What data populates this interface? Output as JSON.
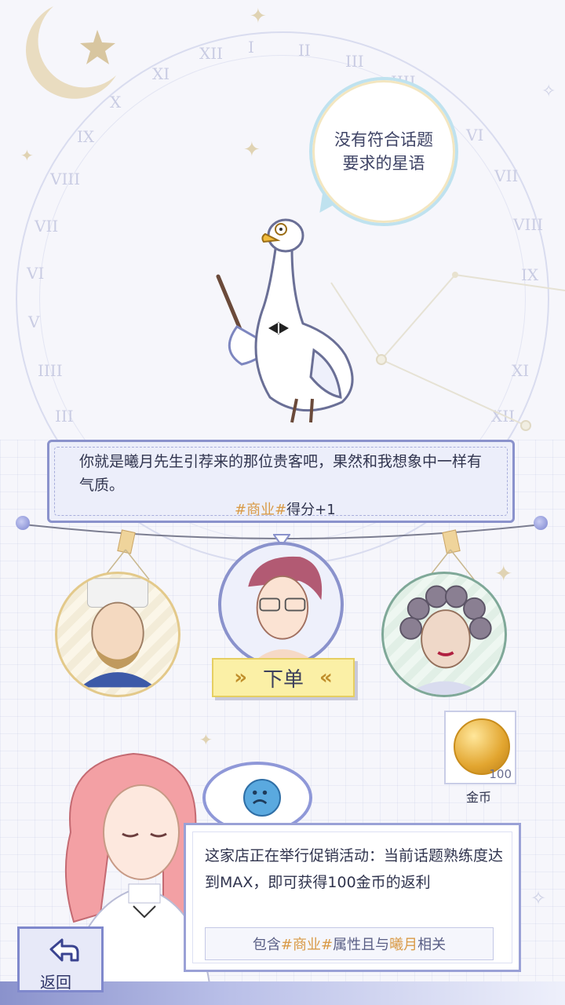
{
  "clock": {
    "numerals": [
      "I",
      "II",
      "III",
      "IIII",
      "V",
      "VI",
      "VII",
      "VIII",
      "IX",
      "X",
      "XI",
      "XII",
      "I",
      "II",
      "III",
      "IIII",
      "V",
      "VI",
      "VII",
      "VIII",
      "IX",
      "X",
      "XI",
      "XII"
    ]
  },
  "speech_bubble": {
    "text": "没有符合话题要求的星语"
  },
  "dialog": {
    "text": "你就是曦月先生引荐来的那位贵客吧，果然和我想象中一样有气质。",
    "score_tag": "#商业#",
    "score_text": "得分+1"
  },
  "order_button": {
    "label": "下单",
    "left_chevron": "»",
    "right_chevron": "«"
  },
  "reward": {
    "amount": "100",
    "label": "金币"
  },
  "hint": {
    "text": "这家店正在举行促销活动：当前话题熟练度达到MAX，即可获得100金币的返利",
    "cond_prefix": "包含",
    "cond_tag": "#商业#",
    "cond_mid": "属性且与",
    "cond_name": "曦月",
    "cond_suffix": "相关"
  },
  "back_button": {
    "label": "返回"
  },
  "colors": {
    "accent": "#8a92cc",
    "highlight": "#d99a46",
    "button_bg": "#fbf0a6"
  }
}
